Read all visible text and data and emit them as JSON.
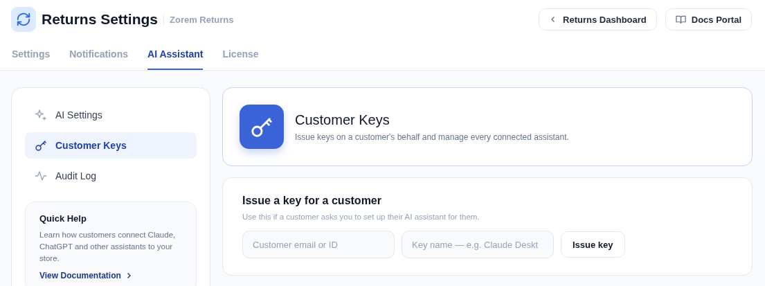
{
  "header": {
    "title": "Returns Settings",
    "subtitle": "Zorem Returns",
    "buttons": [
      {
        "label": "Returns Dashboard"
      },
      {
        "label": "Docs Portal"
      }
    ]
  },
  "tabs": [
    {
      "label": "Settings",
      "selected": false
    },
    {
      "label": "Notifications",
      "selected": false
    },
    {
      "label": "AI Assistant",
      "selected": true
    },
    {
      "label": "License",
      "selected": false
    }
  ],
  "sidebar": {
    "items": [
      {
        "label": "AI Settings",
        "selected": false
      },
      {
        "label": "Customer Keys",
        "selected": true
      },
      {
        "label": "Audit Log",
        "selected": false
      }
    ],
    "help": {
      "title": "Quick Help",
      "text": "Learn how customers connect Claude, ChatGPT and other assistants to your store.",
      "link": "View Documentation"
    }
  },
  "hero": {
    "title": "Customer Keys",
    "text": "Issue keys on a customer's behalf and manage every connected assistant."
  },
  "issue": {
    "title": "Issue a key for a customer",
    "text": "Use this if a customer asks you to set up their AI assistant for them.",
    "fields": [
      {
        "placeholder": "Customer email or ID"
      },
      {
        "placeholder": "Key name — e.g. Claude Deskt"
      }
    ],
    "button": "Issue key"
  }
}
